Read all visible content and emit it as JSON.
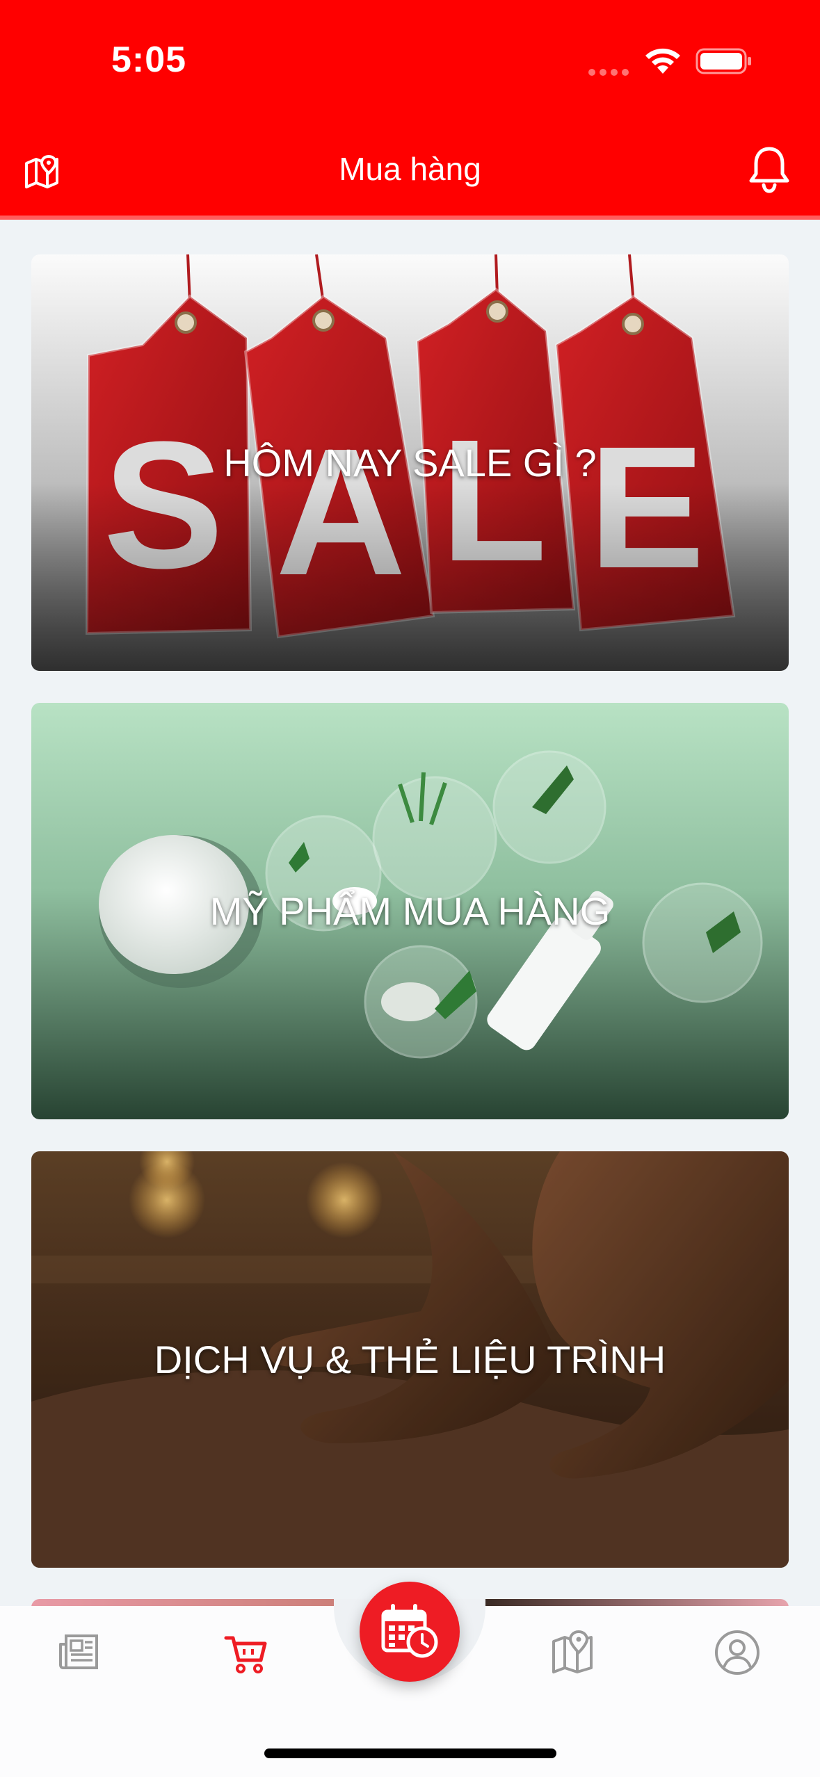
{
  "status_bar": {
    "time": "5:05"
  },
  "header": {
    "title": "Mua hàng",
    "left_icon": "map-pin-icon",
    "right_icon": "bell-icon",
    "bg_color": "#ff0000"
  },
  "cards": [
    {
      "title": "HÔM NAY SALE GÌ ?",
      "image": "sale-tags-image"
    },
    {
      "title": "MỸ PHẨM MUA HÀNG",
      "image": "cosmetics-image"
    },
    {
      "title": "DỊCH VỤ & THẺ LIỆU TRÌNH",
      "image": "massage-image"
    }
  ],
  "bottom_nav": {
    "items": [
      {
        "icon": "news-icon",
        "active": false
      },
      {
        "icon": "cart-icon",
        "active": true
      },
      {
        "icon": "calendar-clock-icon",
        "active": false
      },
      {
        "icon": "map-icon",
        "active": false
      },
      {
        "icon": "user-icon",
        "active": false
      }
    ],
    "active_color": "#ee1c24",
    "inactive_color": "#9a9a9a"
  }
}
